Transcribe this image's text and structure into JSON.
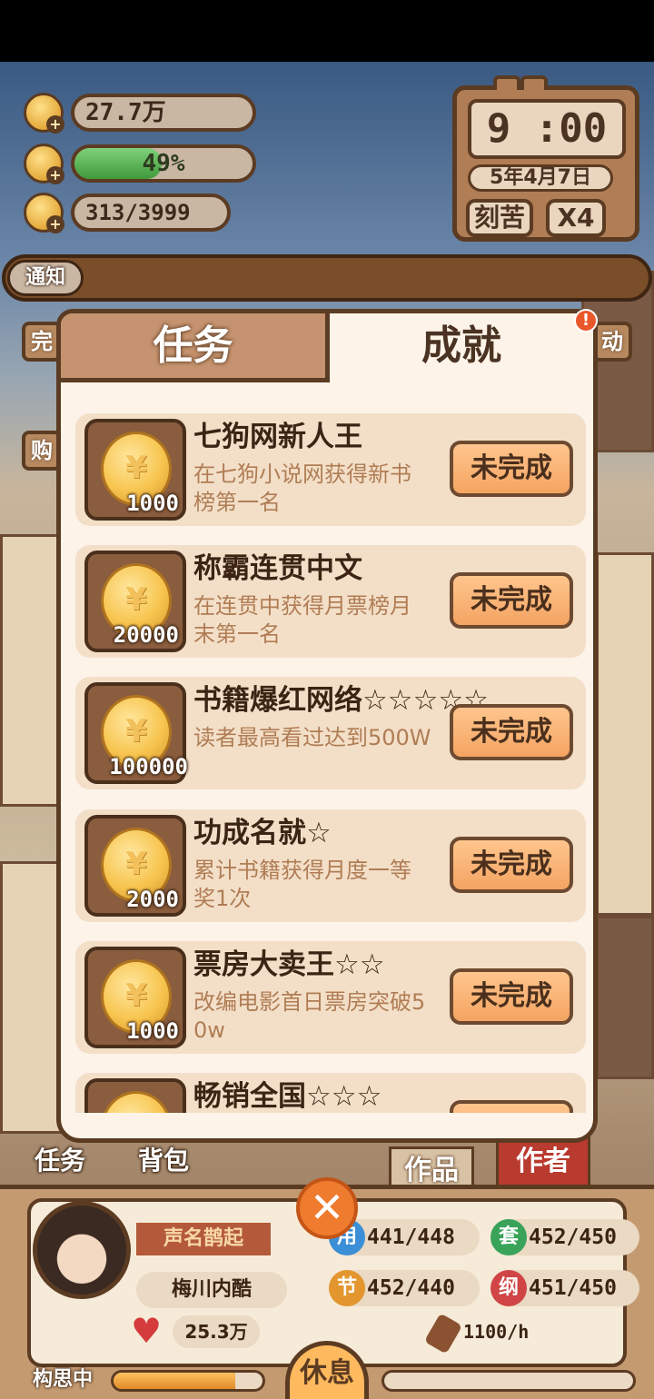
{
  "hud": {
    "gold": "27.7万",
    "energy_text": "49%",
    "energy_level": 0.49,
    "inspiration": "313/3999",
    "time": "9 :00",
    "date": "5年4月7日",
    "mode_label": "刻苦",
    "speed_label": "X4",
    "notice_label": "通知"
  },
  "side": {
    "left1": "完",
    "left2": "购",
    "right1": "动"
  },
  "dialog": {
    "tab_tasks": "任务",
    "tab_achievements": "成就",
    "alert": "!",
    "items": [
      {
        "amount": "1000",
        "title": "七狗网新人王",
        "desc": "在七狗小说网获得新书榜第一名",
        "status": "未完成"
      },
      {
        "amount": "20000",
        "title": "称霸连贯中文",
        "desc": "在连贯中获得月票榜月末第一名",
        "status": "未完成"
      },
      {
        "amount": "100000",
        "title": "书籍爆红网络☆☆☆☆☆",
        "desc": "读者最高看过达到500W",
        "status": "未完成"
      },
      {
        "amount": "2000",
        "title": "功成名就☆",
        "desc": "累计书籍获得月度一等奖1次",
        "status": "未完成"
      },
      {
        "amount": "1000",
        "title": "票房大卖王☆☆",
        "desc": "改编电影首日票房突破50w",
        "status": "未完成"
      },
      {
        "amount": "",
        "title": "畅销全国☆☆☆",
        "desc": "",
        "status": ""
      }
    ]
  },
  "bottom": {
    "nav_tasks": "任务",
    "nav_bag": "背包",
    "nav_works": "作品",
    "nav_author": "作者",
    "close": "✕",
    "rank": "声名鹊起",
    "name": "梅川内酷",
    "fans": "25.3万",
    "stats": [
      {
        "icon": "用",
        "value": "441/448",
        "color": "#3b8fd6"
      },
      {
        "icon": "套",
        "value": "452/450",
        "color": "#3aa35a"
      },
      {
        "icon": "节",
        "value": "452/440",
        "color": "#e3962e"
      },
      {
        "icon": "纲",
        "value": "451/450",
        "color": "#d04545"
      }
    ],
    "rate": "1100/h",
    "think_label": "构思中",
    "think_progress": 0.82,
    "rest_label": "休息"
  }
}
